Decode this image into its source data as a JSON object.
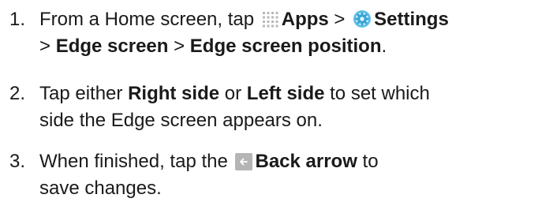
{
  "steps": [
    {
      "number": "1.",
      "line1": {
        "t1": "From a Home screen, tap ",
        "apps": "Apps",
        "sep1": " > ",
        "settings": "Settings"
      },
      "line2": {
        "sep2": "> ",
        "edge_screen": "Edge screen",
        "sep3": " > ",
        "edge_screen_position": "Edge screen position",
        "end": "."
      }
    },
    {
      "number": "2.",
      "line1": {
        "t1": "Tap either ",
        "right_side": "Right side",
        "t2": " or ",
        "left_side": "Left side",
        "t3": " to set which"
      },
      "line2": "side the Edge screen appears on."
    },
    {
      "number": "3.",
      "line1": {
        "t1": "When finished, tap the ",
        "back_arrow": "Back arrow",
        "t2": " to"
      },
      "line2": "save changes."
    }
  ],
  "icons": {
    "apps": "apps-grid-icon",
    "settings": "settings-gear-icon",
    "back": "back-arrow-icon"
  }
}
